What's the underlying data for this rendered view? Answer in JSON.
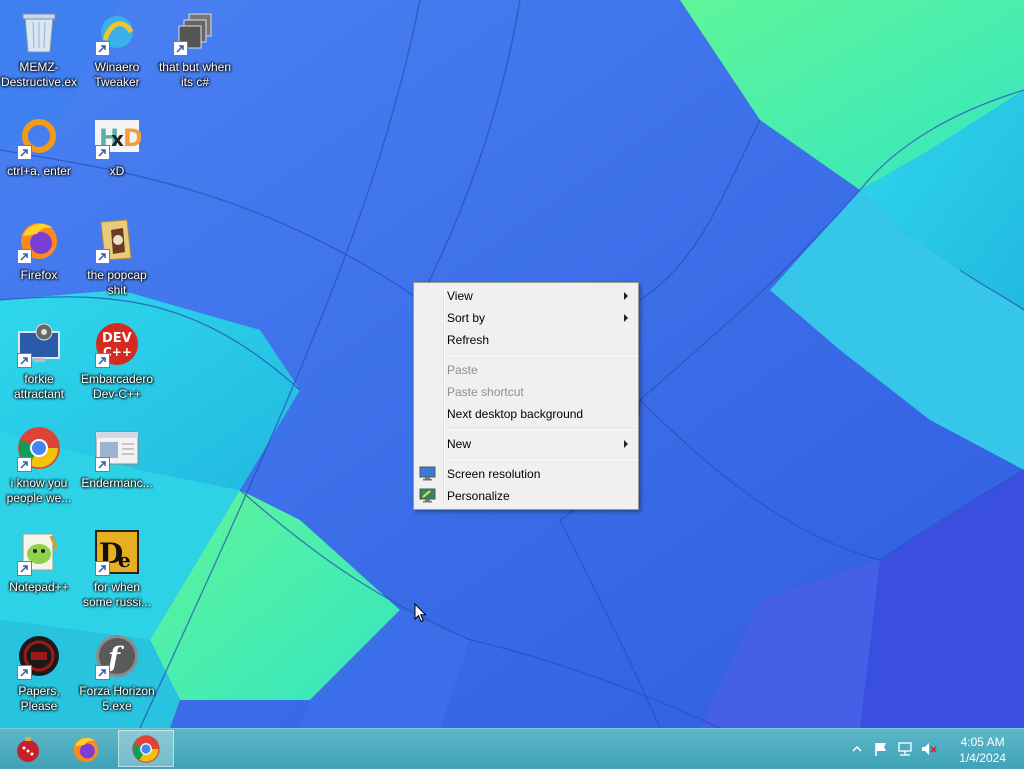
{
  "desktop_icons": [
    {
      "label": "MEMZ-Destructive.exe",
      "icon": "recycle-bin-icon"
    },
    {
      "label": "Winaero Tweaker",
      "icon": "winaero-icon"
    },
    {
      "label": "that but when its c#",
      "icon": "windows-stack-icon"
    },
    {
      "label": "ctrl+a, enter",
      "icon": "orange-ring-icon"
    },
    {
      "label": "xD",
      "icon": "hxd-icon"
    },
    {
      "label": "Firefox",
      "icon": "firefox-icon"
    },
    {
      "label": "the popcap shit",
      "icon": "folder-icon"
    },
    {
      "label": "forkie attractant",
      "icon": "computer-settings-icon"
    },
    {
      "label": "Embarcadero Dev-C++",
      "icon": "devcpp-icon"
    },
    {
      "label": "i know you people we...",
      "icon": "chrome-icon"
    },
    {
      "label": "Endermanc...",
      "icon": "window-app-icon"
    },
    {
      "label": "Notepad++",
      "icon": "notepadpp-icon"
    },
    {
      "label": "for when some russi...",
      "icon": "de-icon"
    },
    {
      "label": "Papers, Please",
      "icon": "papers-please-icon"
    },
    {
      "label": "Forza Horizon 5.exe",
      "icon": "flash-icon"
    }
  ],
  "context_menu": {
    "items": [
      {
        "label": "View",
        "submenu": true,
        "disabled": false
      },
      {
        "label": "Sort by",
        "submenu": true,
        "disabled": false
      },
      {
        "label": "Refresh",
        "submenu": false,
        "disabled": false
      },
      {
        "label": "Paste",
        "submenu": false,
        "disabled": true
      },
      {
        "label": "Paste shortcut",
        "submenu": false,
        "disabled": true
      },
      {
        "label": "Next desktop background",
        "submenu": false,
        "disabled": false
      },
      {
        "label": "New",
        "submenu": true,
        "disabled": false
      },
      {
        "label": "Screen resolution",
        "submenu": false,
        "disabled": false,
        "icon": "display-icon"
      },
      {
        "label": "Personalize",
        "submenu": false,
        "disabled": false,
        "icon": "personalize-icon"
      }
    ]
  },
  "taskbar": {
    "pinned": [
      {
        "name": "ornament-app-icon",
        "active": false
      },
      {
        "name": "firefox-icon",
        "active": false
      },
      {
        "name": "chrome-icon",
        "active": true
      }
    ],
    "tray": [
      "show-hidden-icons-chevron-icon",
      "action-center-flag-icon",
      "network-icon",
      "volume-muted-icon"
    ],
    "clock": {
      "time": "4:05 AM",
      "date": "1/4/2024"
    }
  },
  "colors": {
    "wallpaper_blue": "#3a6fe6",
    "wallpaper_cyan": "#2ed6e8",
    "wallpaper_green": "#4cf0a0",
    "taskbar": "#4aaabf"
  }
}
